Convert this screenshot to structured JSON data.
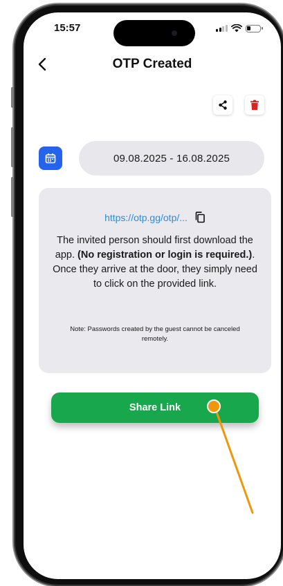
{
  "status_bar": {
    "time": "15:57"
  },
  "header": {
    "title": "OTP Created",
    "back_icon": "chevron-left-icon"
  },
  "actions": {
    "share_icon": "share-icon",
    "delete_icon": "trash-icon"
  },
  "date_range": {
    "calendar_icon": "calendar-icon",
    "text": "09.08.2025 - 16.08.2025"
  },
  "card": {
    "link": "https://otp.gg/otp/...",
    "copy_icon": "copy-icon",
    "description_part1": "The invited person should first download the app. ",
    "description_bold": "(No registration or login is required.)",
    "description_part2": ". Once they arrive at the door, they simply need to click on the provided link.",
    "note": "Note: Passwords created by the guest cannot be canceled remotely."
  },
  "share_button": {
    "label": "Share Link"
  },
  "colors": {
    "primary_blue": "#2563eb",
    "share_green": "#18a74c",
    "delete_red": "#e0211e",
    "link_blue": "#2e8bd6",
    "card_bg": "#e9e9ee",
    "annotation_orange": "#f0960a"
  }
}
